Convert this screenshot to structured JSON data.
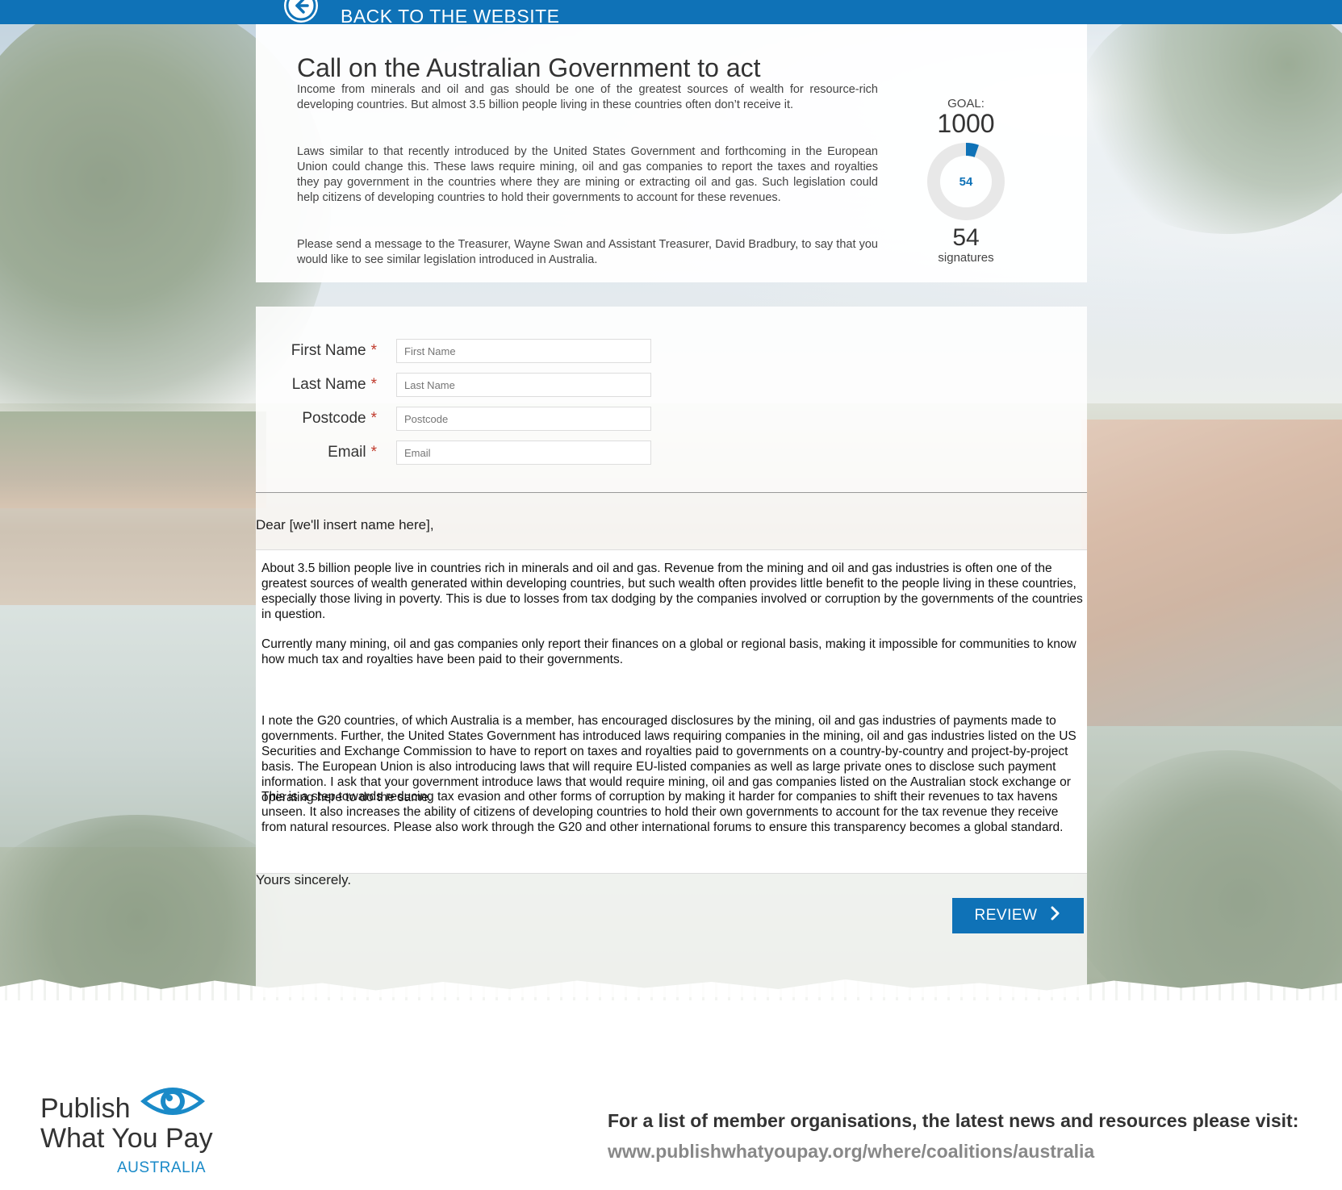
{
  "topbar": {
    "back_label": "BACK TO THE WEBSITE"
  },
  "intro": {
    "title": "Call on the Australian Government to act",
    "paragraphs": [
      "Income from minerals and oil and gas should be one of the greatest sources of wealth for resource-rich developing countries. But almost 3.5 billion people living in these countries often don’t receive it.",
      "Laws similar to that recently introduced by the United States Government and forthcoming in the European Union could change this. These laws require mining, oil and gas companies to report the taxes and royalties they pay government in the countries where they are mining or extracting oil and gas. Such legislation could help citizens of developing countries to hold their governments to account for these revenues.",
      "Please send a message to the Treasurer, Wayne Swan and Assistant Treasurer, David Bradbury, to say that you would like to see similar legislation introduced in Australia."
    ]
  },
  "goal": {
    "label": "GOAL:",
    "target": "1000",
    "progress_center": "54",
    "count": "54",
    "count_label": "signatures",
    "progress_fraction": 0.054,
    "accent_color": "#0f72b7",
    "track_color": "#e8e8e8"
  },
  "form": {
    "required_mark": "*",
    "fields": [
      {
        "label": "First Name",
        "placeholder": "First Name"
      },
      {
        "label": "Last Name",
        "placeholder": "Last Name"
      },
      {
        "label": "Postcode",
        "placeholder": "Postcode"
      },
      {
        "label": "Email",
        "placeholder": "Email"
      }
    ]
  },
  "letter": {
    "greeting": "Dear [we'll insert name here],",
    "paragraphs": [
      "About 3.5 billion people live in countries rich in minerals and oil and gas.  Revenue from the mining and oil and gas industries is often one of the greatest sources of wealth generated within developing countries, but such wealth often provides little benefit to the people living in these countries, especially those living in poverty. This is due to losses from tax dodging by the companies involved or corruption by the governments of the countries in question.",
      "Currently many mining, oil and gas companies only report their finances on a global or regional basis, making it impossible for communities to know how much tax and royalties have been paid to their governments.",
      "I note the G20 countries, of which Australia is a member, has encouraged disclosures by the mining, oil and gas industries of payments made to governments. Further, the United States Government has introduced laws requiring companies in the mining, oil and gas industries listed on the US Securities and Exchange Commission to have to report on taxes and royalties paid to governments on a country-by-country and project-by-project basis. The European Union is also introducing laws that will require EU-listed companies as well as large private ones to disclose such payment information. I ask that your government introduce laws that would require mining, oil and gas companies listed on the Australian stock exchange or operating here to do the same.",
      "This is a step towards reducing tax evasion and other forms of corruption by making it harder for companies to shift their revenues to tax havens unseen. It also increases the ability of citizens of developing countries to hold their own governments to account for the tax revenue they receive from natural resources. Please also work through the G20 and other international forums to ensure this transparency becomes a global standard."
    ],
    "closing": "Yours sincerely.",
    "review_label": "REVIEW",
    "review_icon": "chevron-right-icon"
  },
  "footer": {
    "logo_line1": "Publish",
    "logo_line2": "What You Pay",
    "logo_sub": "AUSTRALIA",
    "text": "For a list of member organisations, the latest news and resources please visit:",
    "url": "www.publishwhatyoupay.org/where/coalitions/australia",
    "brand_color": "#1a8ac8"
  }
}
